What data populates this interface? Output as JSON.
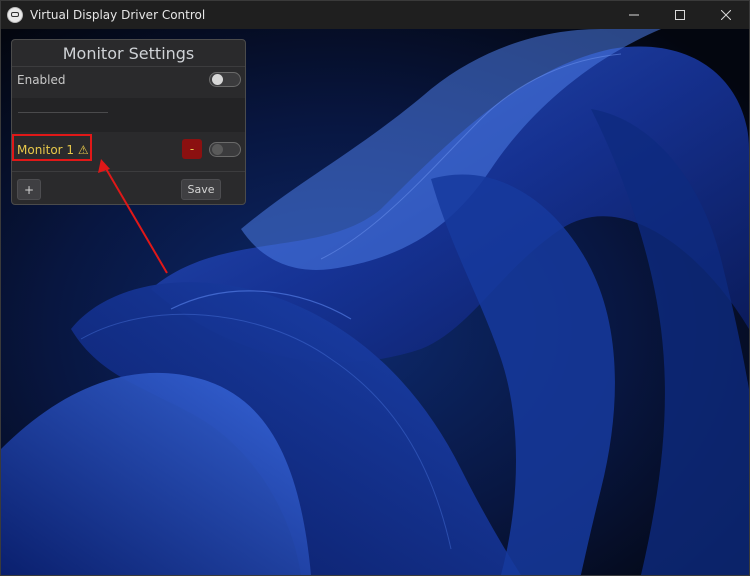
{
  "window": {
    "title": "Virtual Display Driver Control",
    "icon": "display-driver-icon"
  },
  "window_controls": {
    "minimize_icon": "minimize-icon",
    "maximize_icon": "maximize-icon",
    "close_icon": "close-icon"
  },
  "panel": {
    "title": "Monitor Settings",
    "enabled_label": "Enabled",
    "enabled_on": false,
    "new_monitor_value": "",
    "monitors": [
      {
        "label": "Monitor 1 ⚠",
        "remove_label": "-",
        "enabled": false
      }
    ],
    "add_label": "+",
    "save_label": "Save"
  },
  "colors": {
    "panel_bg": "#2a2a2c",
    "warning_text": "#e8c84a",
    "remove_button": "#8b1010",
    "annotation": "#e01818"
  }
}
